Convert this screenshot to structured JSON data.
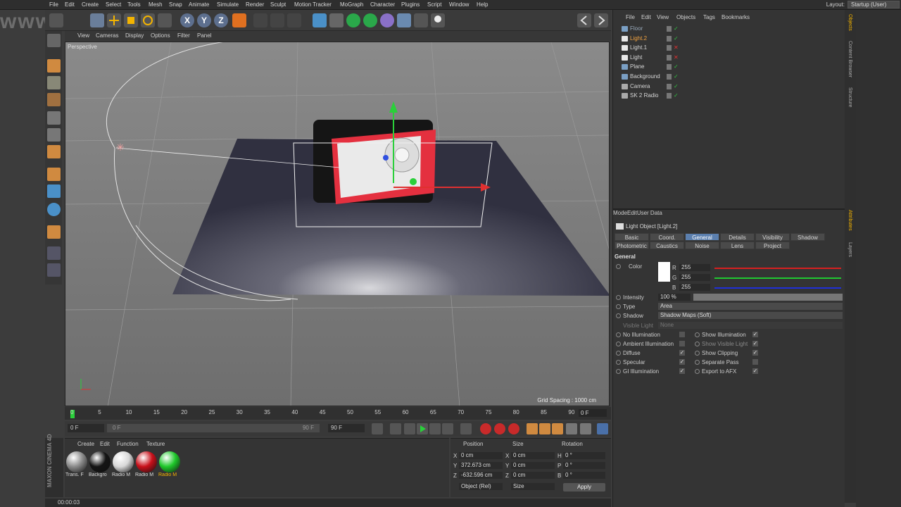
{
  "menubar": {
    "items": [
      "File",
      "Edit",
      "Create",
      "Select",
      "Tools",
      "Mesh",
      "Snap",
      "Animate",
      "Simulate",
      "Render",
      "Sculpt",
      "Motion Tracker",
      "MoGraph",
      "Character",
      "Plugins",
      "Script",
      "Window",
      "Help"
    ],
    "layout_label": "Layout:",
    "layout_value": "Startup (User)"
  },
  "toolbar": {
    "axis_x": "X",
    "axis_y": "Y",
    "axis_z": "Z"
  },
  "viewport": {
    "menu": [
      "View",
      "Cameras",
      "Display",
      "Options",
      "Filter",
      "Panel"
    ],
    "label": "Perspective",
    "grid_spacing": "Grid Spacing : 1000 cm"
  },
  "timeline": {
    "ticks": [
      "0",
      "5",
      "10",
      "15",
      "20",
      "25",
      "30",
      "35",
      "40",
      "45",
      "50",
      "55",
      "60",
      "65",
      "70",
      "75",
      "80",
      "85",
      "90"
    ],
    "current_frame": "0 F",
    "start_field": "0 F",
    "start_inner": "0 F",
    "end_inner": "90 F",
    "end_field": "90 F"
  },
  "materials": {
    "menu": [
      "Create",
      "Edit",
      "Function",
      "Texture"
    ],
    "items": [
      {
        "label": "Trans. F",
        "color": "#8a8a8a"
      },
      {
        "label": "Backgro",
        "color": "#141414"
      },
      {
        "label": "Radio M",
        "color": "#d8d8d8"
      },
      {
        "label": "Radio M",
        "color": "#c8101a"
      },
      {
        "label": "Radio M",
        "color": "#1ec82a"
      }
    ]
  },
  "coords": {
    "headers": [
      "Position",
      "Size",
      "Rotation"
    ],
    "rows": [
      {
        "axis": "X",
        "pos": "0 cm",
        "size_axis": "X",
        "size": "0 cm",
        "rot_axis": "H",
        "rot": "0 °"
      },
      {
        "axis": "Y",
        "pos": "372.673 cm",
        "size_axis": "Y",
        "size": "0 cm",
        "rot_axis": "P",
        "rot": "0 °"
      },
      {
        "axis": "Z",
        "pos": "-632.596 cm",
        "size_axis": "Z",
        "size": "0 cm",
        "rot_axis": "B",
        "rot": "0 °"
      }
    ],
    "mode_object": "Object (Rel)",
    "mode_size": "Size",
    "apply": "Apply"
  },
  "status": {
    "time": "00:00:03"
  },
  "brand": "MAXON CINEMA 4D",
  "watermark": "www.rr-sc.com",
  "objects": {
    "menu": [
      "File",
      "Edit",
      "View",
      "Objects",
      "Tags",
      "Bookmarks"
    ],
    "items": [
      {
        "name": "Floor",
        "color": "#9ab",
        "selected": false,
        "icon": "#7a9fc4"
      },
      {
        "name": "Light.2",
        "color": "#f3a340",
        "selected": true,
        "icon": "#e8e8e8"
      },
      {
        "name": "Light.1",
        "color": "#d5d5d5",
        "selected": false,
        "icon": "#e8e8e8"
      },
      {
        "name": "Light",
        "color": "#d5d5d5",
        "selected": false,
        "icon": "#e8e8e8"
      },
      {
        "name": "Plane",
        "color": "#d5d5d5",
        "selected": false,
        "icon": "#7a9fc4"
      },
      {
        "name": "Background",
        "color": "#d5d5d5",
        "selected": false,
        "icon": "#7a9fc4"
      },
      {
        "name": "Camera",
        "color": "#d5d5d5",
        "selected": false,
        "icon": "#aaaaaa"
      },
      {
        "name": "SK 2 Radio",
        "color": "#d5d5d5",
        "selected": false,
        "icon": "#aaaaaa"
      }
    ]
  },
  "sidetabs": [
    "Objects",
    "Content Browser",
    "Structure",
    "Attributes",
    "Layers"
  ],
  "attributes": {
    "menu": [
      "Mode",
      "Edit",
      "User Data"
    ],
    "title": "Light Object [Light.2]",
    "tabs_row1": [
      "Basic",
      "Coord.",
      "General",
      "Details",
      "Visibility",
      "Shadow"
    ],
    "tabs_row2": [
      "Photometric",
      "Caustics",
      "Noise",
      "Lens",
      "Project"
    ],
    "active_tab": "General",
    "section": "General",
    "color_label": "Color",
    "r_label": "R",
    "r_value": "255",
    "g_label": "G",
    "g_value": "255",
    "b_label": "B",
    "b_value": "255",
    "intensity_label": "Intensity",
    "intensity_value": "100 %",
    "type_label": "Type",
    "type_value": "Area",
    "shadow_label": "Shadow",
    "shadow_value": "Shadow Maps (Soft)",
    "visible_light_label": "Visible Light",
    "visible_light_value": "None",
    "checks_left": [
      {
        "label": "No Illumination",
        "checked": false
      },
      {
        "label": "Ambient Illumination",
        "checked": false
      },
      {
        "label": "Diffuse",
        "checked": true
      },
      {
        "label": "Specular",
        "checked": true
      },
      {
        "label": "GI Illumination",
        "checked": true
      }
    ],
    "checks_right": [
      {
        "label": "Show Illumination",
        "checked": true
      },
      {
        "label": "Show Visible Light",
        "checked": true
      },
      {
        "label": "Show Clipping",
        "checked": true
      },
      {
        "label": "Separate Pass",
        "checked": false
      },
      {
        "label": "Export to AFX",
        "checked": true
      }
    ]
  }
}
